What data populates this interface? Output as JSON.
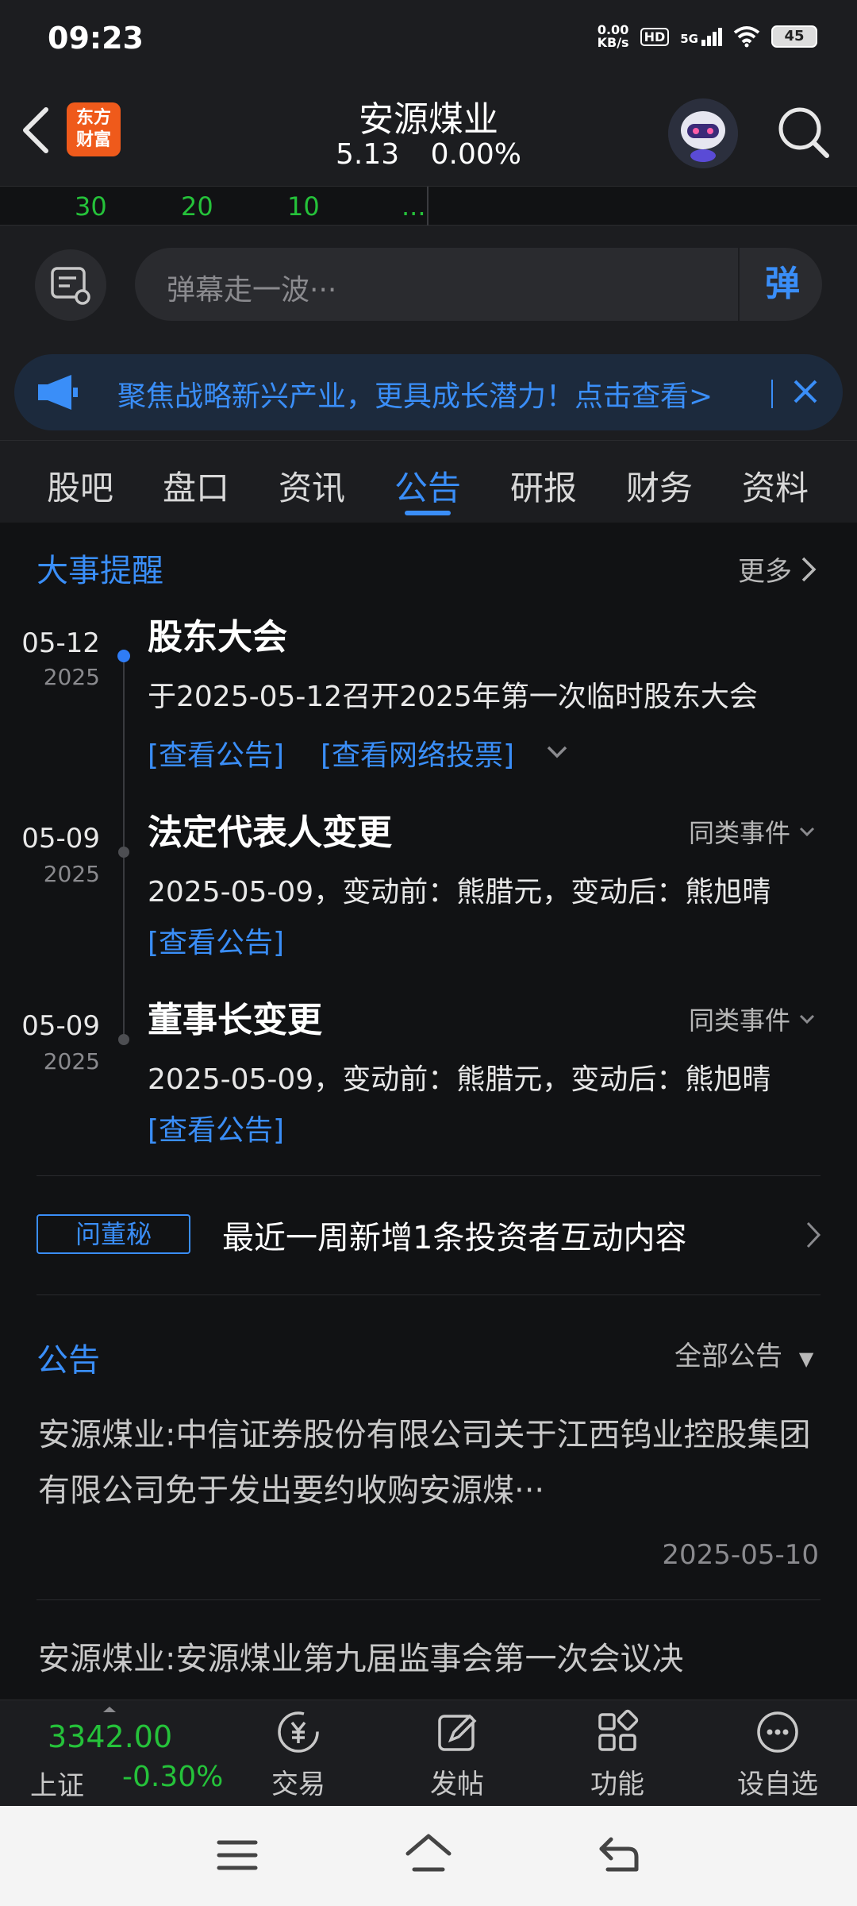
{
  "status_bar": {
    "time": "09:23",
    "net_speed_value": "0.00",
    "net_speed_unit": "KB/s",
    "hd": "HD",
    "network": "5G",
    "battery": "45"
  },
  "header": {
    "logo_line1": "东方",
    "logo_line2": "财富",
    "stock_name": "安源煤业",
    "price": "5.13",
    "change_pct": "0.00%"
  },
  "strip": {
    "values": [
      "30",
      "20",
      "10",
      "..."
    ]
  },
  "danmaku": {
    "placeholder": "弹幕走一波···",
    "button": "弹"
  },
  "promo": {
    "text": "聚焦战略新兴产业，更具成长潜力！点击查看>"
  },
  "tabs": [
    {
      "label": "股吧"
    },
    {
      "label": "盘口"
    },
    {
      "label": "资讯"
    },
    {
      "label": "公告"
    },
    {
      "label": "研报"
    },
    {
      "label": "财务"
    },
    {
      "label": "资料"
    }
  ],
  "events": {
    "title": "大事提醒",
    "more": "更多",
    "items": [
      {
        "date": "05-12",
        "year": "2025",
        "title": "股东大会",
        "desc": "于2025-05-12召开2025年第一次临时股东大会",
        "link1": "[查看公告]",
        "link2": "[查看网络投票]"
      },
      {
        "date": "05-09",
        "year": "2025",
        "title": "法定代表人变更",
        "same": "同类事件",
        "desc": "2025-05-09，变动前：熊腊元，变动后：熊旭晴",
        "link1": "[查看公告]"
      },
      {
        "date": "05-09",
        "year": "2025",
        "title": "董事长变更",
        "same": "同类事件",
        "desc": "2025-05-09，变动前：熊腊元，变动后：熊旭晴",
        "link1": "[查看公告]"
      }
    ]
  },
  "qa": {
    "badge": "问董秘",
    "text": "最近一周新增1条投资者互动内容"
  },
  "announcements": {
    "title": "公告",
    "filter": "全部公告",
    "items": [
      {
        "title": "安源煤业:中信证券股份有限公司关于江西钨业控股集团有限公司免于发出要约收购安源煤···",
        "date": "2025-05-10"
      },
      {
        "title": "安源煤业:安源煤业第九届监事会第一次会议决"
      }
    ]
  },
  "bottom_bar": {
    "index_value": "3342.00",
    "index_name": "上证",
    "index_change": "-0.30%",
    "nav": [
      {
        "label": "交易",
        "icon": "trade-yuan-icon"
      },
      {
        "label": "发帖",
        "icon": "edit-post-icon"
      },
      {
        "label": "功能",
        "icon": "grid-functions-icon"
      },
      {
        "label": "设自选",
        "icon": "more-dots-icon"
      }
    ]
  },
  "colors": {
    "accent": "#3a8ef8",
    "green": "#25c23a",
    "background": "#111214",
    "panel": "#1c1d20"
  }
}
